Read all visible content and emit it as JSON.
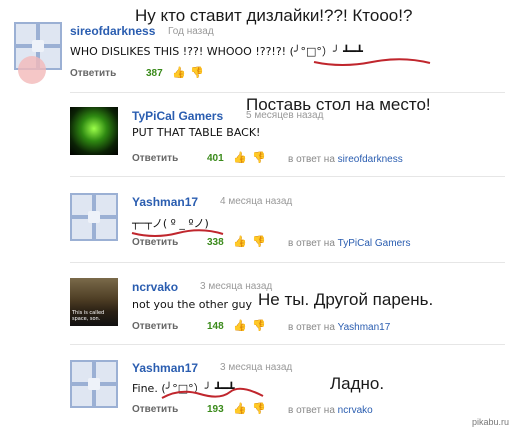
{
  "overlays": {
    "o1": "Ну кто ставит дизлайки!??! Ктооо!?",
    "o2": "Поставь стол на место!",
    "o3": "Не ты. Другой парень.",
    "o4": "Ладно."
  },
  "comments": [
    {
      "user": "sireofdarkness",
      "time": "Год назад",
      "body": "WHO DISLIKES THIS !??! WHOOO !??!?! (╯°□°）╯ ┻━┻",
      "reply": "Ответить",
      "score": "387",
      "in_reply_prefix": "",
      "in_reply_user": ""
    },
    {
      "user": "TyPiCal Gamers",
      "time": "5 месяцев назад",
      "body": "PUT THAT TABLE BACK!",
      "reply": "Ответить",
      "score": "401",
      "in_reply_prefix": "в ответ на",
      "in_reply_user": "sireofdarkness"
    },
    {
      "user": "Yashman17",
      "time": "4 месяца назад",
      "body": "┬─┬ノ( º _ ºノ)",
      "reply": "Ответить",
      "score": "338",
      "in_reply_prefix": "в ответ на",
      "in_reply_user": "TyPiCal Gamers"
    },
    {
      "user": "ncrvako",
      "time": "3 месяца назад",
      "body": "not you the other guy",
      "reply": "Ответить",
      "score": "148",
      "in_reply_prefix": "в ответ на",
      "in_reply_user": "Yashman17"
    },
    {
      "user": "Yashman17",
      "time": "3 месяца назад",
      "body": "Fine. (╯°□°）╯ ┻━┻",
      "reply": "Ответить",
      "score": "193",
      "in_reply_prefix": "в ответ на",
      "in_reply_user": "ncrvako"
    }
  ],
  "icons": {
    "thumb_up": "thumbs-up-icon",
    "thumb_down": "thumbs-down-icon"
  },
  "colors": {
    "link": "#2a5db0",
    "score": "#3a8a1a",
    "underline": "#c0262d"
  },
  "watermark": "pikabu.ru"
}
